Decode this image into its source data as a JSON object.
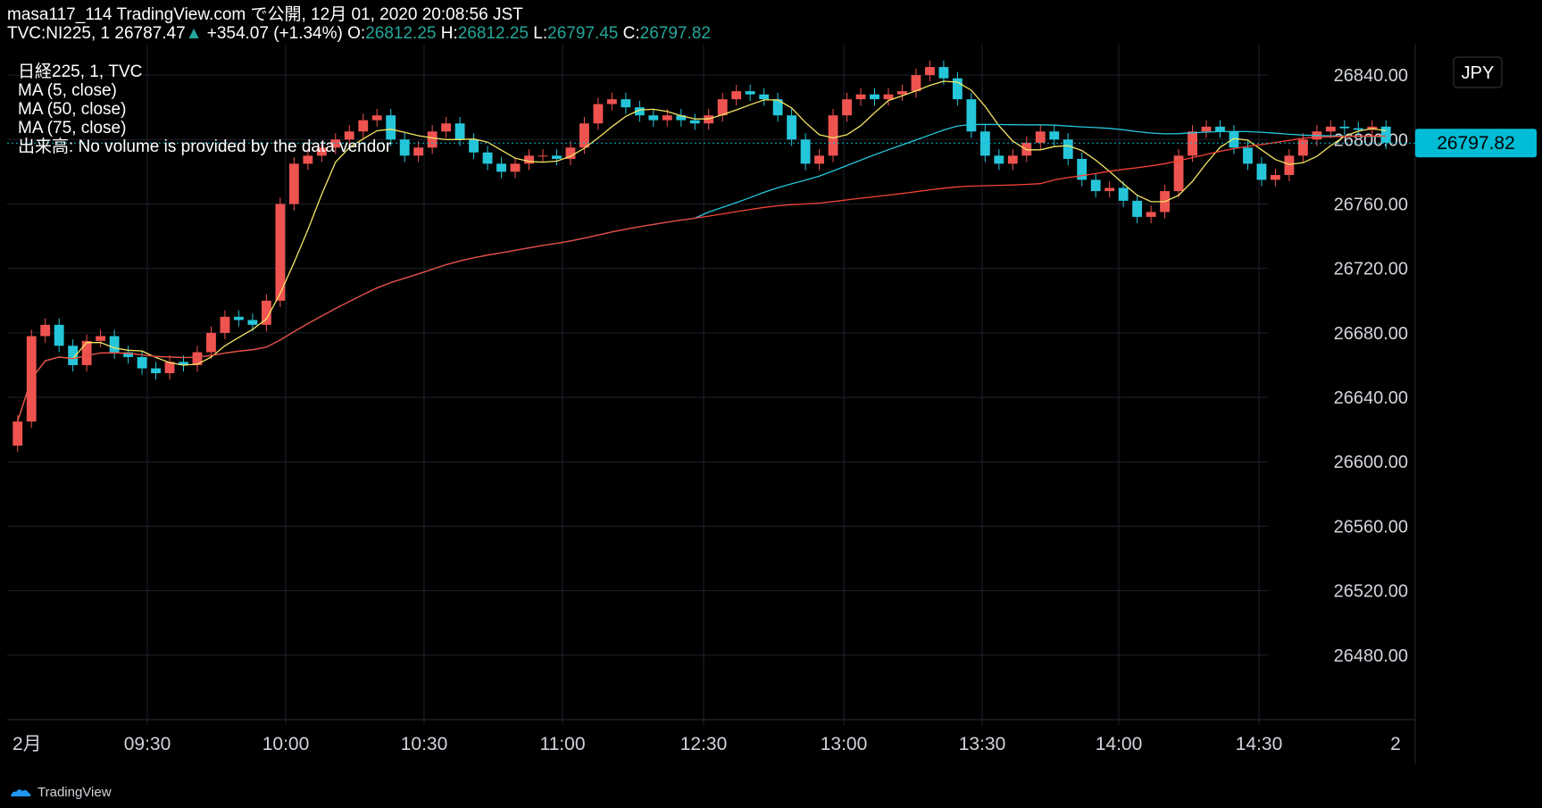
{
  "header": {
    "line1": "masa117_114 TradingView.com で公開, 12月 01, 2020 20:08:56 JST",
    "symbol": "TVC:NI225, 1",
    "last": "26787.47",
    "arrow": "▲",
    "change": "+354.07 (+1.34%)",
    "o_label": "O:",
    "o_val": "26812.25",
    "h_label": "H:",
    "h_val": "26812.25",
    "l_label": "L:",
    "l_val": "26797.45",
    "c_label": "C:",
    "c_val": "26797.82"
  },
  "legend": [
    "日経225, 1, TVC",
    "MA (5, close)",
    "MA (50, close)",
    "MA (75, close)",
    "出来高: No volume is provided by the data vendor"
  ],
  "currency_button": "JPY",
  "price_tag": "26797.82",
  "footer": {
    "brand": "TradingView"
  },
  "colors": {
    "background": "#000000",
    "grid": "#1e222d",
    "up": "#ef5350",
    "down": "#26c6da",
    "ma5": "#f5e663",
    "ma50": "#26c6da",
    "ma75": "#f44336",
    "price_tag_bg": "#00bcd4"
  },
  "chart_data": {
    "type": "candlestick",
    "title": "日経225, 1, TVC",
    "x_tick_labels": [
      "2月",
      "09:30",
      "10:00",
      "10:30",
      "11:00",
      "12:30",
      "13:00",
      "13:30",
      "14:00",
      "14:30",
      "2"
    ],
    "y_tick_labels": [
      "26840.00",
      "26800.00",
      "26760.00",
      "26720.00",
      "26680.00",
      "26640.00",
      "26600.00",
      "26560.00",
      "26520.00",
      "26480.00"
    ],
    "ylim": [
      26440,
      26860
    ],
    "grid": true,
    "last_price": 26797.82,
    "ohlc_last": {
      "open": 26812.25,
      "high": 26812.25,
      "low": 26797.45,
      "close": 26797.82
    },
    "series_close": [
      [
        0,
        26625
      ],
      [
        1,
        26678
      ],
      [
        2,
        26685
      ],
      [
        3,
        26672
      ],
      [
        4,
        26660
      ],
      [
        5,
        26675
      ],
      [
        6,
        26678
      ],
      [
        7,
        26668
      ],
      [
        8,
        26665
      ],
      [
        9,
        26658
      ],
      [
        10,
        26655
      ],
      [
        11,
        26662
      ],
      [
        12,
        26660
      ],
      [
        13,
        26668
      ],
      [
        14,
        26680
      ],
      [
        15,
        26690
      ],
      [
        16,
        26688
      ],
      [
        17,
        26685
      ],
      [
        18,
        26700
      ],
      [
        19,
        26760
      ],
      [
        20,
        26785
      ],
      [
        21,
        26790
      ],
      [
        22,
        26795
      ],
      [
        23,
        26800
      ],
      [
        24,
        26805
      ],
      [
        25,
        26812
      ],
      [
        26,
        26815
      ],
      [
        27,
        26800
      ],
      [
        28,
        26790
      ],
      [
        29,
        26795
      ],
      [
        30,
        26805
      ],
      [
        31,
        26810
      ],
      [
        32,
        26800
      ],
      [
        33,
        26792
      ],
      [
        34,
        26785
      ],
      [
        35,
        26780
      ],
      [
        36,
        26785
      ],
      [
        37,
        26790
      ],
      [
        38,
        26790
      ],
      [
        39,
        26788
      ],
      [
        40,
        26795
      ],
      [
        41,
        26810
      ],
      [
        42,
        26822
      ],
      [
        43,
        26825
      ],
      [
        44,
        26820
      ],
      [
        45,
        26815
      ],
      [
        46,
        26812
      ],
      [
        47,
        26815
      ],
      [
        48,
        26812
      ],
      [
        49,
        26810
      ],
      [
        50,
        26815
      ],
      [
        51,
        26825
      ],
      [
        52,
        26830
      ],
      [
        53,
        26828
      ],
      [
        54,
        26825
      ],
      [
        55,
        26815
      ],
      [
        56,
        26800
      ],
      [
        57,
        26785
      ],
      [
        58,
        26790
      ],
      [
        59,
        26815
      ],
      [
        60,
        26825
      ],
      [
        61,
        26828
      ],
      [
        62,
        26825
      ],
      [
        63,
        26828
      ],
      [
        64,
        26830
      ],
      [
        65,
        26840
      ],
      [
        66,
        26845
      ],
      [
        67,
        26838
      ],
      [
        68,
        26825
      ],
      [
        69,
        26805
      ],
      [
        70,
        26790
      ],
      [
        71,
        26785
      ],
      [
        72,
        26790
      ],
      [
        73,
        26798
      ],
      [
        74,
        26805
      ],
      [
        75,
        26800
      ],
      [
        76,
        26788
      ],
      [
        77,
        26775
      ],
      [
        78,
        26768
      ],
      [
        79,
        26770
      ],
      [
        80,
        26762
      ],
      [
        81,
        26752
      ],
      [
        82,
        26755
      ],
      [
        83,
        26768
      ],
      [
        84,
        26790
      ],
      [
        85,
        26805
      ],
      [
        86,
        26808
      ],
      [
        87,
        26805
      ],
      [
        88,
        26795
      ],
      [
        89,
        26785
      ],
      [
        90,
        26775
      ],
      [
        91,
        26778
      ],
      [
        92,
        26790
      ],
      [
        93,
        26800
      ],
      [
        94,
        26805
      ],
      [
        95,
        26808
      ],
      [
        96,
        26807
      ],
      [
        97,
        26806
      ],
      [
        98,
        26808
      ],
      [
        99,
        26798
      ]
    ]
  }
}
